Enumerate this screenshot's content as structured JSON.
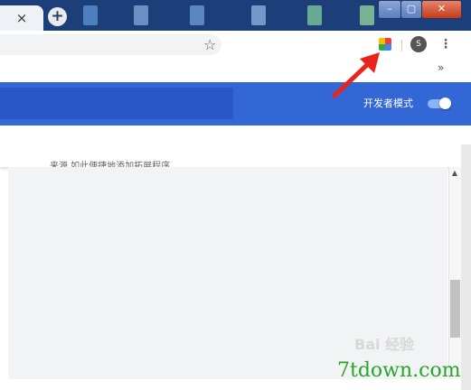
{
  "tabstrip": {
    "tab_close_glyph": "×",
    "new_tab_glyph": "+"
  },
  "window_controls": {
    "minimize": "–",
    "maximize": "▢",
    "close": "✕"
  },
  "toolbar": {
    "star_glyph": "☆",
    "avatar_letter": "S",
    "menu_glyph": "⋮"
  },
  "bookmarks": {
    "overflow_glyph": "»"
  },
  "header": {
    "developer_mode_label": "开发者模式",
    "developer_mode_on": true
  },
  "content": {
    "clipped_text": "来源 如此便捷地添加拓展程序"
  },
  "scrollbar": {
    "up_glyph": "▲"
  },
  "watermark": {
    "baidu": "Bai  经验",
    "site": "7tdown.com"
  },
  "colors": {
    "header_blue": "#3367d6",
    "arrow_red": "#e8251a",
    "site_green": "#27a62a"
  }
}
